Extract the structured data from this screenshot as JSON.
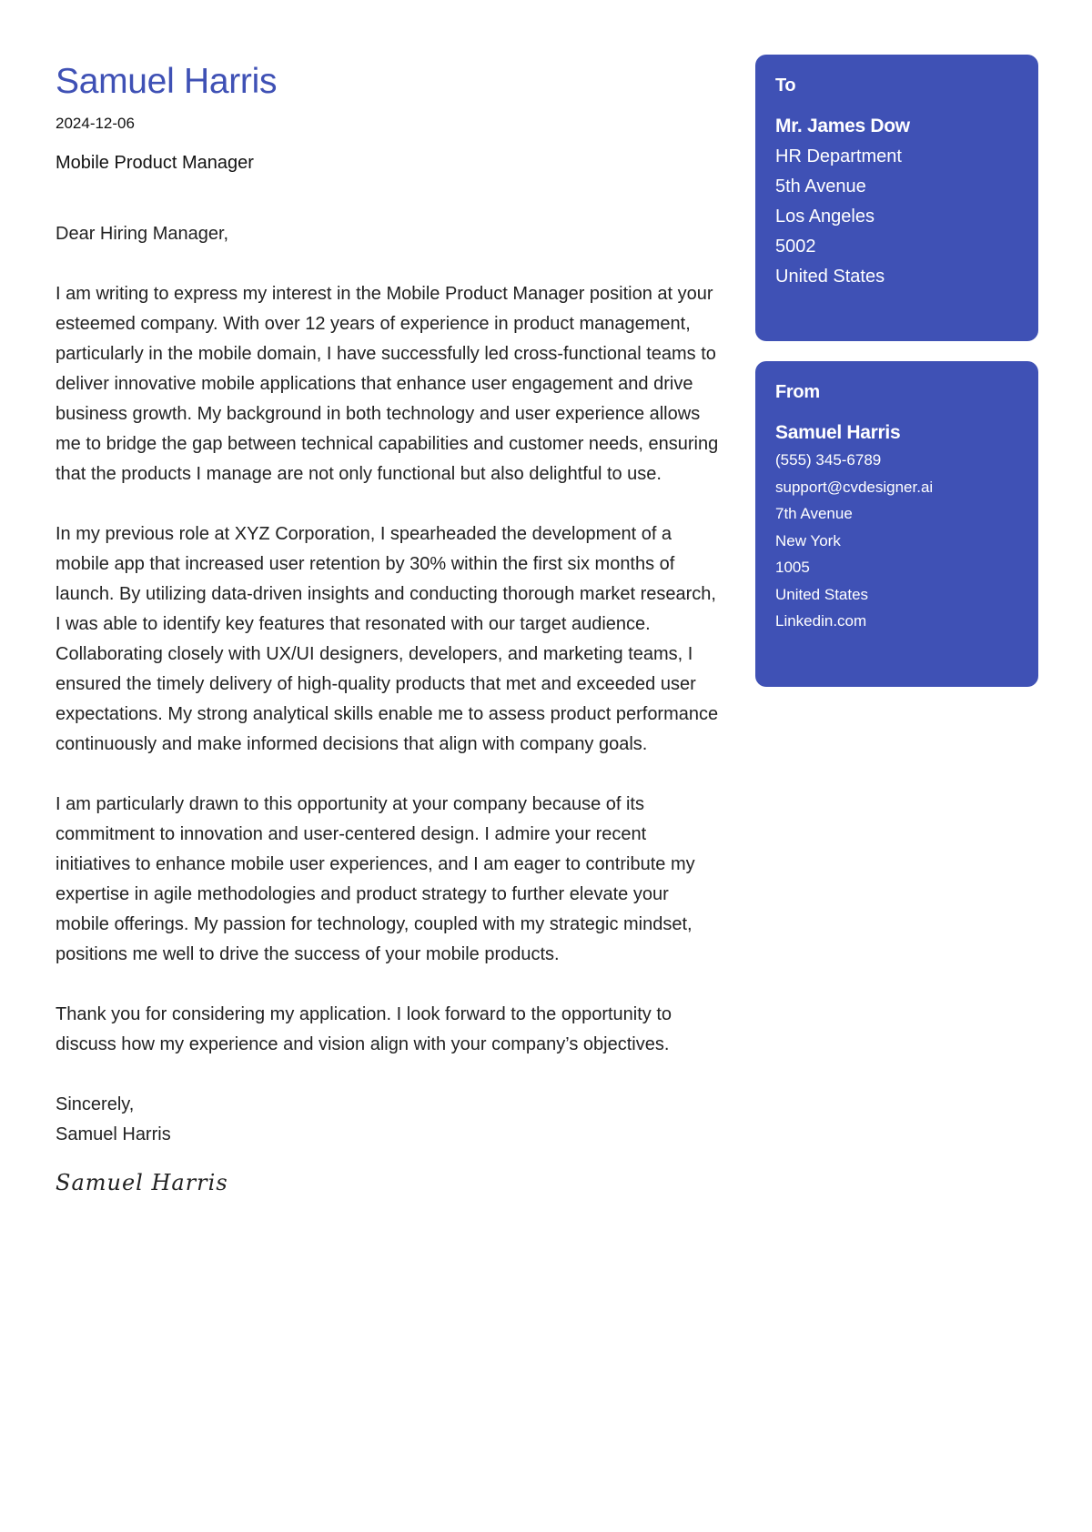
{
  "sender": {
    "name": "Samuel Harris",
    "date": "2024-12-06",
    "job_title": "Mobile Product Manager"
  },
  "letter": {
    "salutation": "Dear Hiring Manager,",
    "paragraphs": [
      "I am writing to express my interest in the Mobile Product Manager position at your esteemed company. With over 12 years of experience in product management, particularly in the mobile domain, I have successfully led cross-functional teams to deliver innovative mobile applications that enhance user engagement and drive business growth. My background in both technology and user experience allows me to bridge the gap between technical capabilities and customer needs, ensuring that the products I manage are not only functional but also delightful to use.",
      "In my previous role at XYZ Corporation, I spearheaded the development of a mobile app that increased user retention by 30% within the first six months of launch. By utilizing data-driven insights and conducting thorough market research, I was able to identify key features that resonated with our target audience. Collaborating closely with UX/UI designers, developers, and marketing teams, I ensured the timely delivery of high-quality products that met and exceeded user expectations. My strong analytical skills enable me to assess product performance continuously and make informed decisions that align with company goals.",
      "I am particularly drawn to this opportunity at your company because of its commitment to innovation and user-centered design. I admire your recent initiatives to enhance mobile user experiences, and I am eager to contribute my expertise in agile methodologies and product strategy to further elevate your mobile offerings. My passion for technology, coupled with my strategic mindset, positions me well to drive the success of your mobile products.",
      "Thank you for considering my application. I look forward to the opportunity to discuss how my experience and vision align with your company’s objectives."
    ],
    "closing": "Sincerely,",
    "closing_name": "Samuel Harris",
    "signature": "Samuel Harris"
  },
  "to_card": {
    "label": "To",
    "name": "Mr. James Dow",
    "lines": [
      "HR Department",
      "5th Avenue",
      "Los Angeles",
      "5002",
      "United States"
    ]
  },
  "from_card": {
    "label": "From",
    "name": "Samuel Harris",
    "phone": "(555) 345-6789",
    "email": "support@cvdesigner.ai",
    "street": "7th Avenue",
    "city": "New York",
    "zip": "1005",
    "country": "United States",
    "website": "Linkedin.com"
  },
  "colors": {
    "accent": "#3f51b5",
    "text": "#222222",
    "card_text": "#ffffff"
  }
}
